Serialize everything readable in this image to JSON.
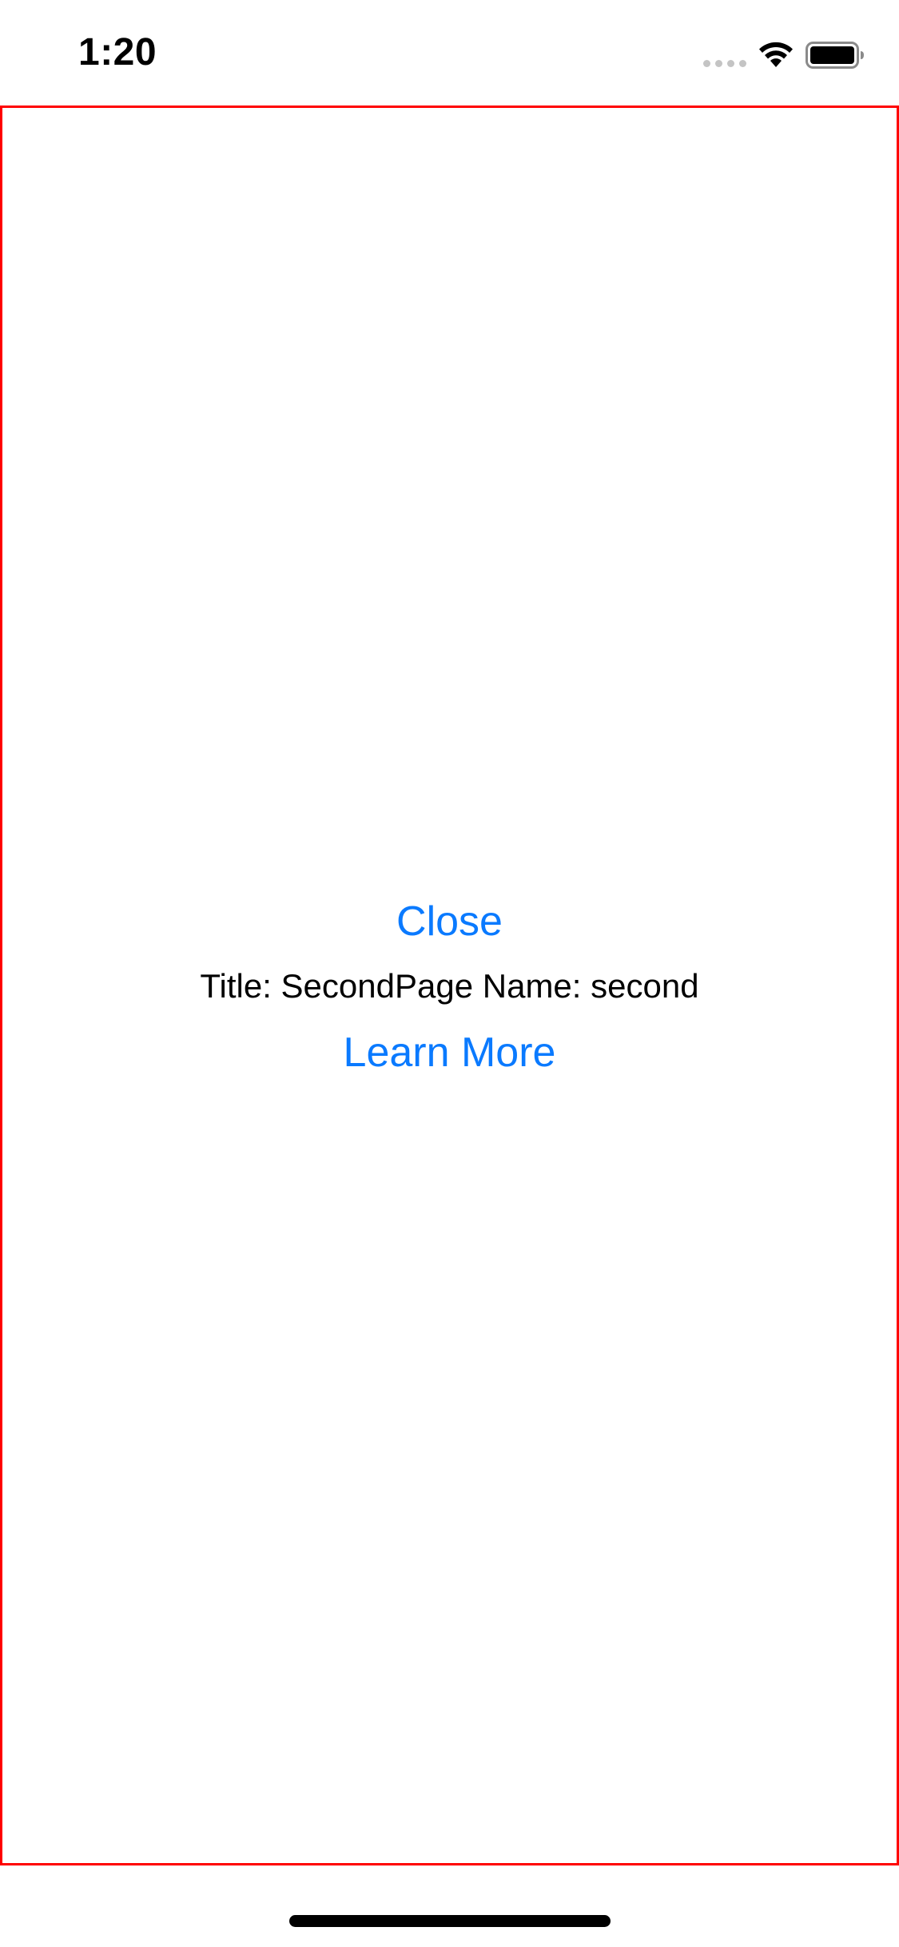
{
  "status_bar": {
    "time": "1:20",
    "signal_icon": "cellular-signal-icon",
    "wifi_icon": "wifi-icon",
    "battery_icon": "battery-icon"
  },
  "main": {
    "close_label": "Close",
    "title_text": "Title: SecondPage Name: second",
    "learn_more_label": "Learn More"
  },
  "colors": {
    "link": "#0a7aff",
    "frame_border": "#ff0000",
    "text": "#000000",
    "background": "#ffffff"
  }
}
